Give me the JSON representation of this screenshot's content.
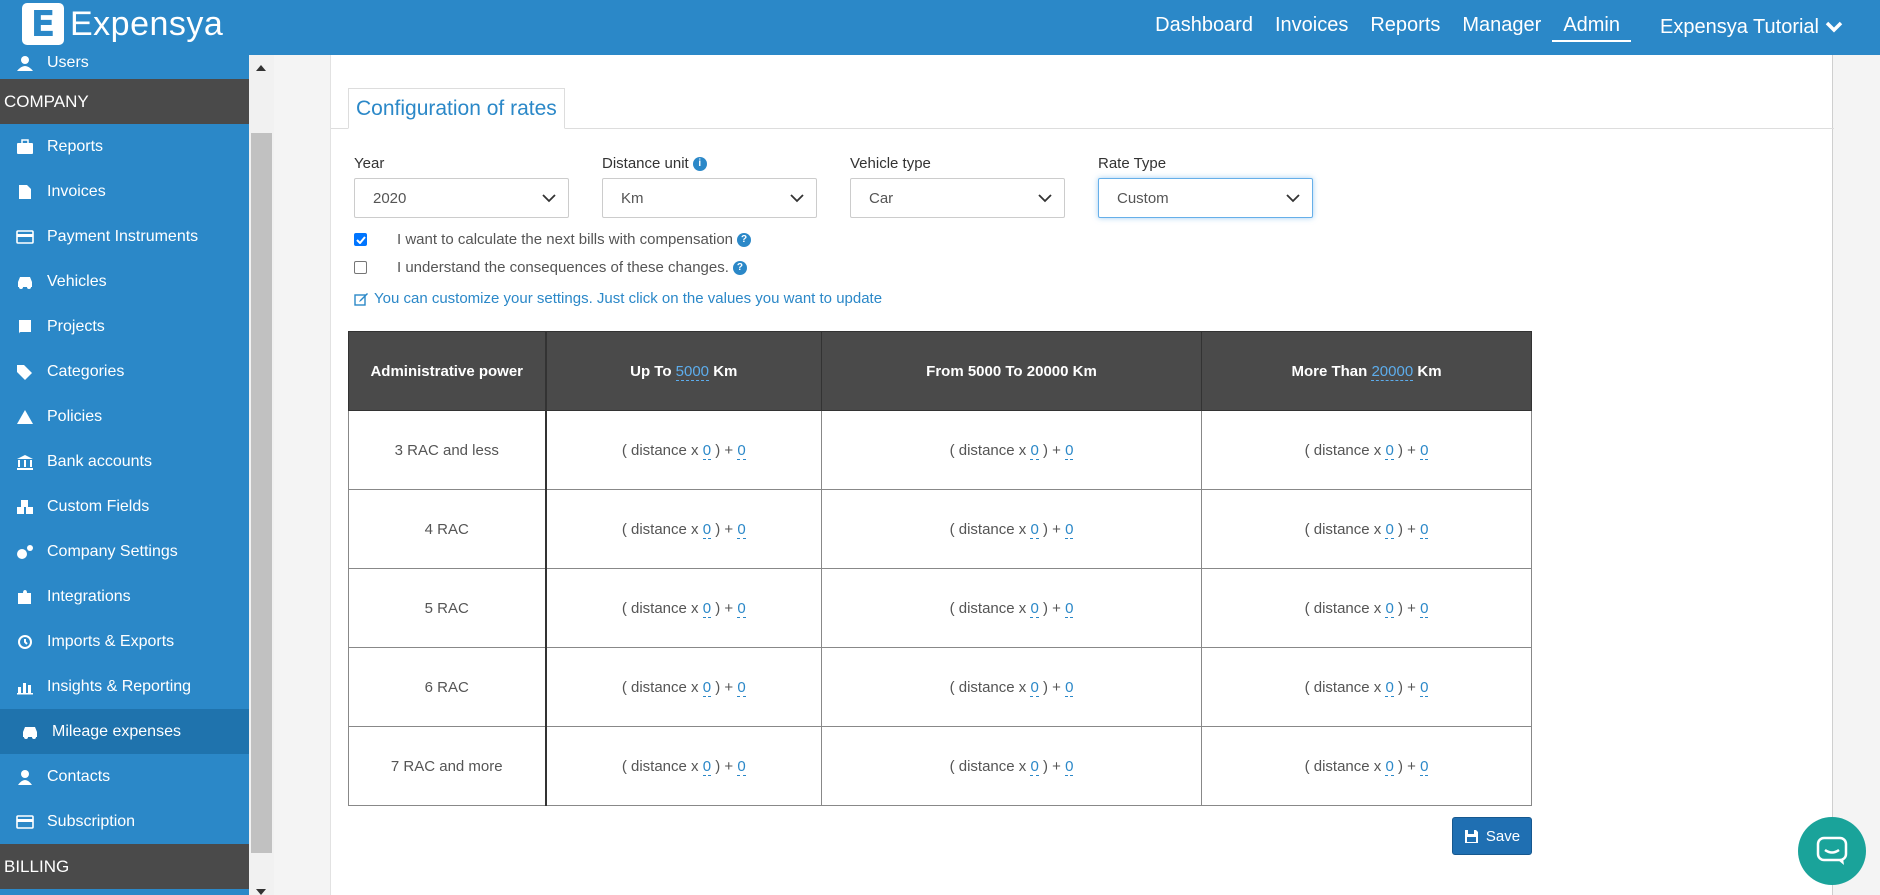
{
  "app": {
    "logo_letter": "E",
    "name": "Expensya"
  },
  "nav": {
    "items": [
      "Dashboard",
      "Invoices",
      "Reports",
      "Manager",
      "Admin"
    ],
    "active": "Admin",
    "user": "Expensya Tutorial"
  },
  "sidebar": {
    "top_item": "Users",
    "company_section": "COMPANY",
    "items": [
      {
        "label": "Reports",
        "icon": "briefcase-icon"
      },
      {
        "label": "Invoices",
        "icon": "document-icon"
      },
      {
        "label": "Payment Instruments",
        "icon": "credit-card-icon"
      },
      {
        "label": "Vehicles",
        "icon": "car-icon"
      },
      {
        "label": "Projects",
        "icon": "book-icon"
      },
      {
        "label": "Categories",
        "icon": "tags-icon"
      },
      {
        "label": "Policies",
        "icon": "warning-icon"
      },
      {
        "label": "Bank accounts",
        "icon": "bank-icon"
      },
      {
        "label": "Custom Fields",
        "icon": "cubes-icon"
      },
      {
        "label": "Company Settings",
        "icon": "gears-icon"
      },
      {
        "label": "Integrations",
        "icon": "puzzle-icon"
      },
      {
        "label": "Imports & Exports",
        "icon": "history-icon"
      },
      {
        "label": "Insights & Reporting",
        "icon": "bar-chart-icon"
      },
      {
        "label": "Mileage expenses",
        "icon": "car-icon",
        "active": true
      },
      {
        "label": "Contacts",
        "icon": "user-icon"
      },
      {
        "label": "Subscription",
        "icon": "credit-card-icon"
      }
    ],
    "billing_section": "BILLING"
  },
  "config": {
    "tab_title": "Configuration of rates",
    "year": {
      "label": "Year",
      "value": "2020"
    },
    "distance_unit": {
      "label": "Distance unit",
      "value": "Km"
    },
    "vehicle_type": {
      "label": "Vehicle type",
      "value": "Car"
    },
    "rate_type": {
      "label": "Rate Type",
      "value": "Custom"
    },
    "check_compensation": {
      "label": "I want to calculate the next bills with compensation",
      "checked": true
    },
    "check_consequences": {
      "label": "I understand the consequences of these changes.",
      "checked": false
    },
    "hint": "You can customize your settings. Just click on the values you want to update"
  },
  "table": {
    "headers": {
      "power": "Administrative power",
      "upto_prefix": "Up To",
      "upto_value": "5000",
      "upto_suffix": "Km",
      "range": "From 5000 To 20000 Km",
      "more_prefix": "More Than",
      "more_value": "20000",
      "more_suffix": "Km"
    },
    "formula": {
      "open": "( distance x",
      "plus": ") +"
    },
    "rows": [
      {
        "power": "3 RAC and less",
        "cells": [
          {
            "a": "0",
            "b": "0"
          },
          {
            "a": "0",
            "b": "0"
          },
          {
            "a": "0",
            "b": "0"
          }
        ]
      },
      {
        "power": "4 RAC",
        "cells": [
          {
            "a": "0",
            "b": "0"
          },
          {
            "a": "0",
            "b": "0"
          },
          {
            "a": "0",
            "b": "0"
          }
        ]
      },
      {
        "power": "5 RAC",
        "cells": [
          {
            "a": "0",
            "b": "0"
          },
          {
            "a": "0",
            "b": "0"
          },
          {
            "a": "0",
            "b": "0"
          }
        ]
      },
      {
        "power": "6 RAC",
        "cells": [
          {
            "a": "0",
            "b": "0"
          },
          {
            "a": "0",
            "b": "0"
          },
          {
            "a": "0",
            "b": "0"
          }
        ]
      },
      {
        "power": "7 RAC and more",
        "cells": [
          {
            "a": "0",
            "b": "0"
          },
          {
            "a": "0",
            "b": "0"
          },
          {
            "a": "0",
            "b": "0"
          }
        ]
      }
    ]
  },
  "save_label": "Save",
  "colors": {
    "primary": "#2b88c8",
    "dark": "#4a4a4a",
    "active_sidebar": "#1f73ad",
    "chat": "#1aa39a"
  }
}
